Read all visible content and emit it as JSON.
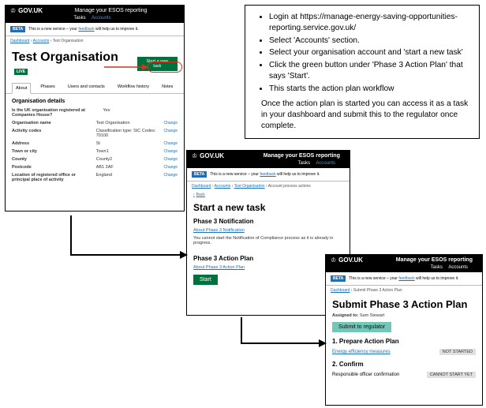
{
  "govuk": "GOV.UK",
  "serviceTitle": "Manage your ESOS reporting",
  "nav": {
    "tasks": "Tasks",
    "accounts": "Accounts"
  },
  "beta": {
    "tag": "BETA",
    "text": "This is a new service – your ",
    "link": "feedback",
    "text2": " will help us to improve it."
  },
  "screen1": {
    "breadcrumb": {
      "a": "Dashboard",
      "b": "Accounts",
      "c": "Test Organisation"
    },
    "h1": "Test Organisation",
    "tag": "LIVE",
    "tabs": {
      "about": "About",
      "phases": "Phases",
      "users": "Users and contacts",
      "workflow": "Workflow history",
      "notes": "Notes"
    },
    "button": "Start a new task",
    "sectionTitle": "Organisation details",
    "rows": {
      "r1l": "Is the UK organisation registered at Companies House?",
      "r1v": "Yes",
      "r2l": "Organisation name",
      "r2v": "Test Organisation",
      "r3l": "Activity codes",
      "r3v": "Classification type: SIC Codes: 70100",
      "r4l": "Address",
      "r4v": "St",
      "r5l": "Town or city",
      "r5v": "Town1",
      "r6l": "County",
      "r6v": "County2",
      "r7l": "Postcode",
      "r7v": "AB1 2AF",
      "r8l": "Location of registered office or principal place of activity",
      "r8v": "England"
    },
    "change": "Change"
  },
  "screen2": {
    "breadcrumb": {
      "a": "Dashboard",
      "b": "Accounts",
      "c": "Test Organisation",
      "d": "Account process actions"
    },
    "back": "Back",
    "h1": "Start a new task",
    "sec1": "Phase 3 Notification",
    "link1": "About Phase 3 Notification",
    "note1": "You cannot start the Notification of Compliance process as it is already in progress.",
    "sec2": "Phase 3 Action Plan",
    "link2": "About Phase 3 Action Plan",
    "start": "Start"
  },
  "screen3": {
    "breadcrumb": {
      "a": "Dashboard",
      "b": "Submit Phase 3 Action Plan"
    },
    "h1": "Submit Phase 3 Action Plan",
    "assignedLabel": "Assigned to: ",
    "assigned": "Sam Stewart",
    "submit": "Submit to regulator",
    "s1": "1. Prepare Action Plan",
    "s1link": "Energy efficiency measures",
    "s1tag": "NOT STARTED",
    "s2": "2. Confirm",
    "s2link": "Responsible officer confirmation",
    "s2tag": "CANNOT START YET"
  },
  "instructions": {
    "b1": "Login at https://manage-energy-saving-opportunities-reporting.service.gov.uk/",
    "b2": "Select 'Accounts' section.",
    "b3": "Select your organisation account and 'start a new task'",
    "b4": "Click the green button under 'Phase 3 Action Plan' that says 'Start'.",
    "b5": "This starts the action plan workflow",
    "footer": "Once the action plan is started you can access it as a task in your dashboard and submit this to the regulator once complete."
  }
}
